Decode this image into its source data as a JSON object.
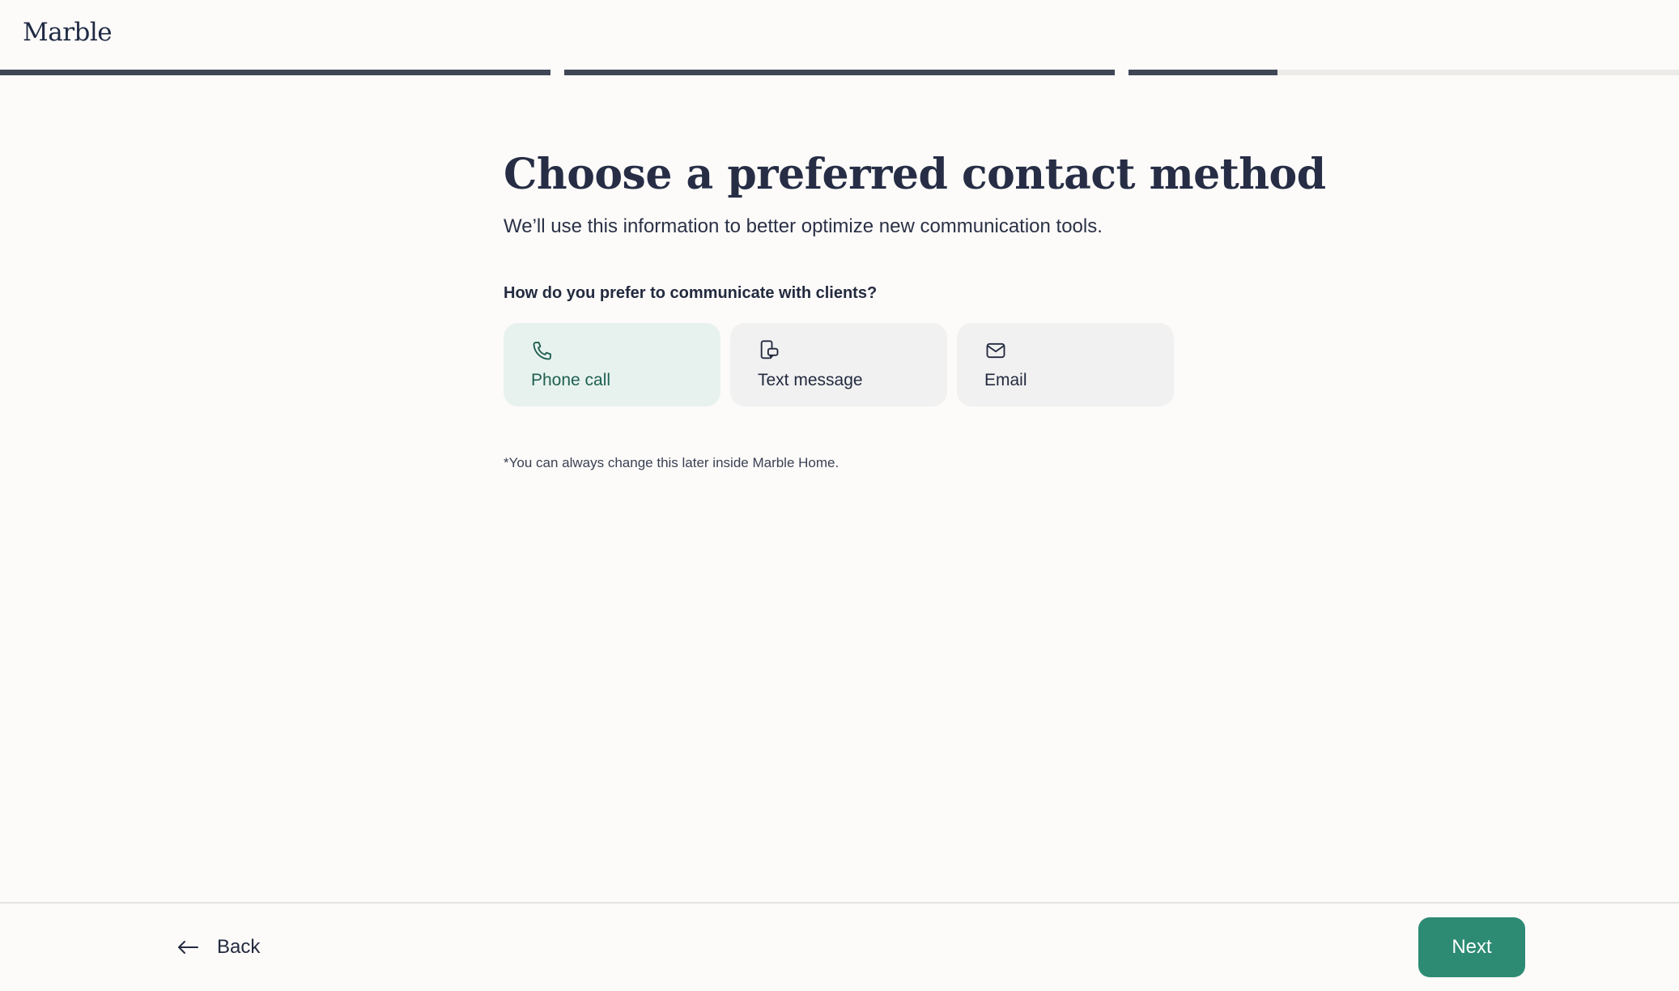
{
  "app": {
    "logo": "Marble"
  },
  "progress": {
    "steps": [
      1,
      1,
      0.27
    ]
  },
  "main": {
    "title": "Choose a preferred contact method",
    "subtitle": "We’ll use this information to better optimize new communication tools.",
    "question": "How do you prefer to communicate with clients?",
    "options": [
      {
        "label": "Phone call",
        "icon": "phone-icon",
        "selected": true
      },
      {
        "label": "Text message",
        "icon": "text-message-icon",
        "selected": false
      },
      {
        "label": "Email",
        "icon": "envelope-icon",
        "selected": false
      }
    ],
    "note": "*You can always change this later inside Marble Home."
  },
  "footer": {
    "back_label": "Back",
    "next_label": "Next"
  },
  "colors": {
    "accent": "#2d8b73",
    "selected_bg": "#e7f2ef",
    "progress_fill": "#3f4656",
    "text": "#232a3f"
  }
}
